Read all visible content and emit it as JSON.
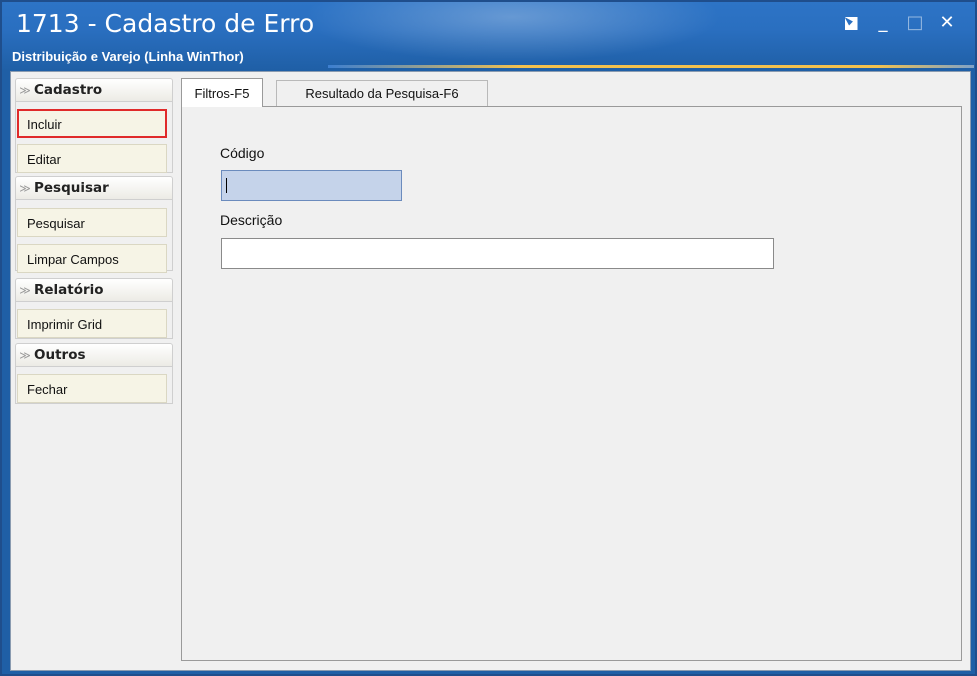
{
  "window": {
    "title": "1713 - Cadastro de Erro",
    "subtitle": "Distribuição e Varejo (Linha WinThor)",
    "controls": {
      "close_glyph": "✕",
      "minimize_glyph": "_",
      "maximize_glyph": "□"
    }
  },
  "sidebar": {
    "groups": [
      {
        "label": "Cadastro",
        "items": [
          "Incluir",
          "Editar"
        ]
      },
      {
        "label": "Pesquisar",
        "items": [
          "Pesquisar",
          "Limpar Campos"
        ]
      },
      {
        "label": "Relatório",
        "items": [
          "Imprimir Grid"
        ]
      },
      {
        "label": "Outros",
        "items": [
          "Fechar"
        ]
      }
    ],
    "chevron_glyph": "≫",
    "active_item": "Incluir"
  },
  "tabs": [
    {
      "label": "Filtros-F5",
      "active": true
    },
    {
      "label": "Resultado da Pesquisa-F6",
      "active": false
    }
  ],
  "form": {
    "codigo_label": "Código",
    "codigo_value": "",
    "descricao_label": "Descrição",
    "descricao_value": ""
  },
  "colors": {
    "titlebar": "#2a6fc0",
    "accent": "#f2c14e",
    "active_border": "#e02a2a",
    "focused_input": "#c5d3ea"
  }
}
